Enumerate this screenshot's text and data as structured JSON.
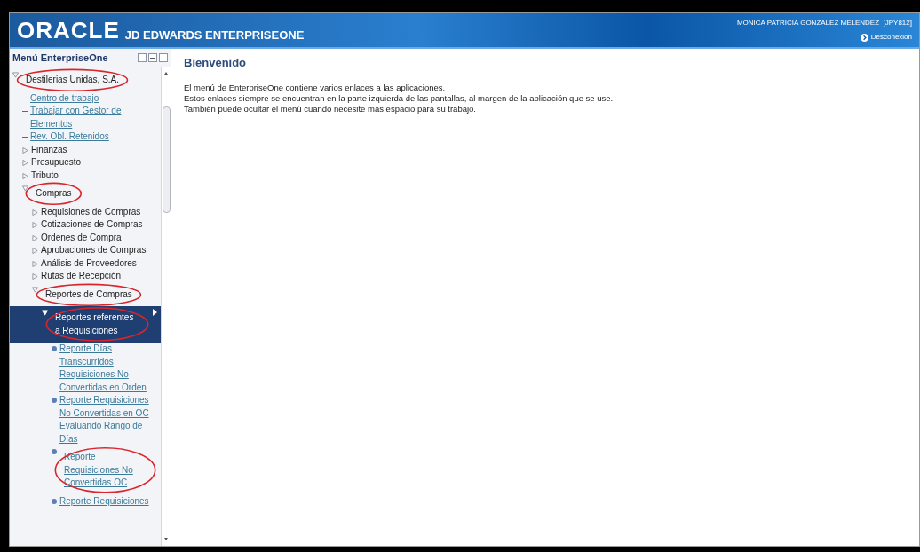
{
  "header": {
    "logo": "ORACLE",
    "product": "JD EDWARDS ENTERPRISEONE",
    "user": "MONICA PATRICIA GONZALEZ MELENDEZ  [JPY812]",
    "logout": "Desconexión"
  },
  "sidebar": {
    "title": "Menú EnterpriseOne",
    "tree": [
      {
        "kind": "folder",
        "label": "Destilerias Unidas, S.A.",
        "expanded": true,
        "selected": false,
        "circled": true,
        "children": [
          {
            "kind": "link",
            "label": "Centro de trabajo",
            "selected": false,
            "circled": false
          },
          {
            "kind": "link",
            "label": "Trabajar con Gestor de Elementos",
            "selected": false,
            "circled": false
          },
          {
            "kind": "link",
            "label": "Rev. Obl. Retenidos",
            "selected": false,
            "circled": false
          },
          {
            "kind": "folder",
            "label": "Finanzas",
            "expanded": false,
            "selected": false,
            "circled": false
          },
          {
            "kind": "folder",
            "label": "Presupuesto",
            "expanded": false,
            "selected": false,
            "circled": false
          },
          {
            "kind": "folder",
            "label": "Tributo",
            "expanded": false,
            "selected": false,
            "circled": false
          },
          {
            "kind": "folder",
            "label": "Compras",
            "expanded": true,
            "selected": false,
            "circled": true,
            "children": [
              {
                "kind": "folder",
                "label": "Requisiones de Compras",
                "expanded": false,
                "selected": false,
                "circled": false
              },
              {
                "kind": "folder",
                "label": "Cotizaciones de Compras",
                "expanded": false,
                "selected": false,
                "circled": false
              },
              {
                "kind": "folder",
                "label": "Ordenes de Compra",
                "expanded": false,
                "selected": false,
                "circled": false
              },
              {
                "kind": "folder",
                "label": "Aprobaciones de Compras",
                "expanded": false,
                "selected": false,
                "circled": false
              },
              {
                "kind": "folder",
                "label": "Análisis de Proveedores",
                "expanded": false,
                "selected": false,
                "circled": false
              },
              {
                "kind": "folder",
                "label": "Rutas de Recepción",
                "expanded": false,
                "selected": false,
                "circled": false
              },
              {
                "kind": "folder",
                "label": "Reportes de Compras",
                "expanded": true,
                "selected": false,
                "circled": true,
                "children": [
                  {
                    "kind": "folder",
                    "label": "Reportes referentes a Requisiciones",
                    "expanded": true,
                    "selected": true,
                    "circled": true,
                    "children": [
                      {
                        "kind": "task",
                        "label": "Reporte Días Transcurridos Requisiciones No Convertidas en Orden",
                        "selected": false,
                        "circled": false
                      },
                      {
                        "kind": "task",
                        "label": "Reporte Requisiciones No Convertidas en OC Evaluando Rango de Días",
                        "selected": false,
                        "circled": false
                      },
                      {
                        "kind": "task",
                        "label": "Reporte Requisiciones No Convertidas OC",
                        "selected": false,
                        "circled": true
                      },
                      {
                        "kind": "task",
                        "label": "Reporte Requisiciones",
                        "selected": false,
                        "circled": false
                      }
                    ]
                  }
                ]
              }
            ]
          }
        ]
      }
    ]
  },
  "main": {
    "title": "Bienvenido",
    "lines": [
      "El menú de EnterpriseOne contiene varios enlaces a las aplicaciones.",
      "Estos enlaces siempre se encuentran en la parte izquierda de las pantallas, al margen de la aplicación que se use.",
      "También puede ocultar el menú cuando necesite más espacio para su trabajo."
    ]
  }
}
